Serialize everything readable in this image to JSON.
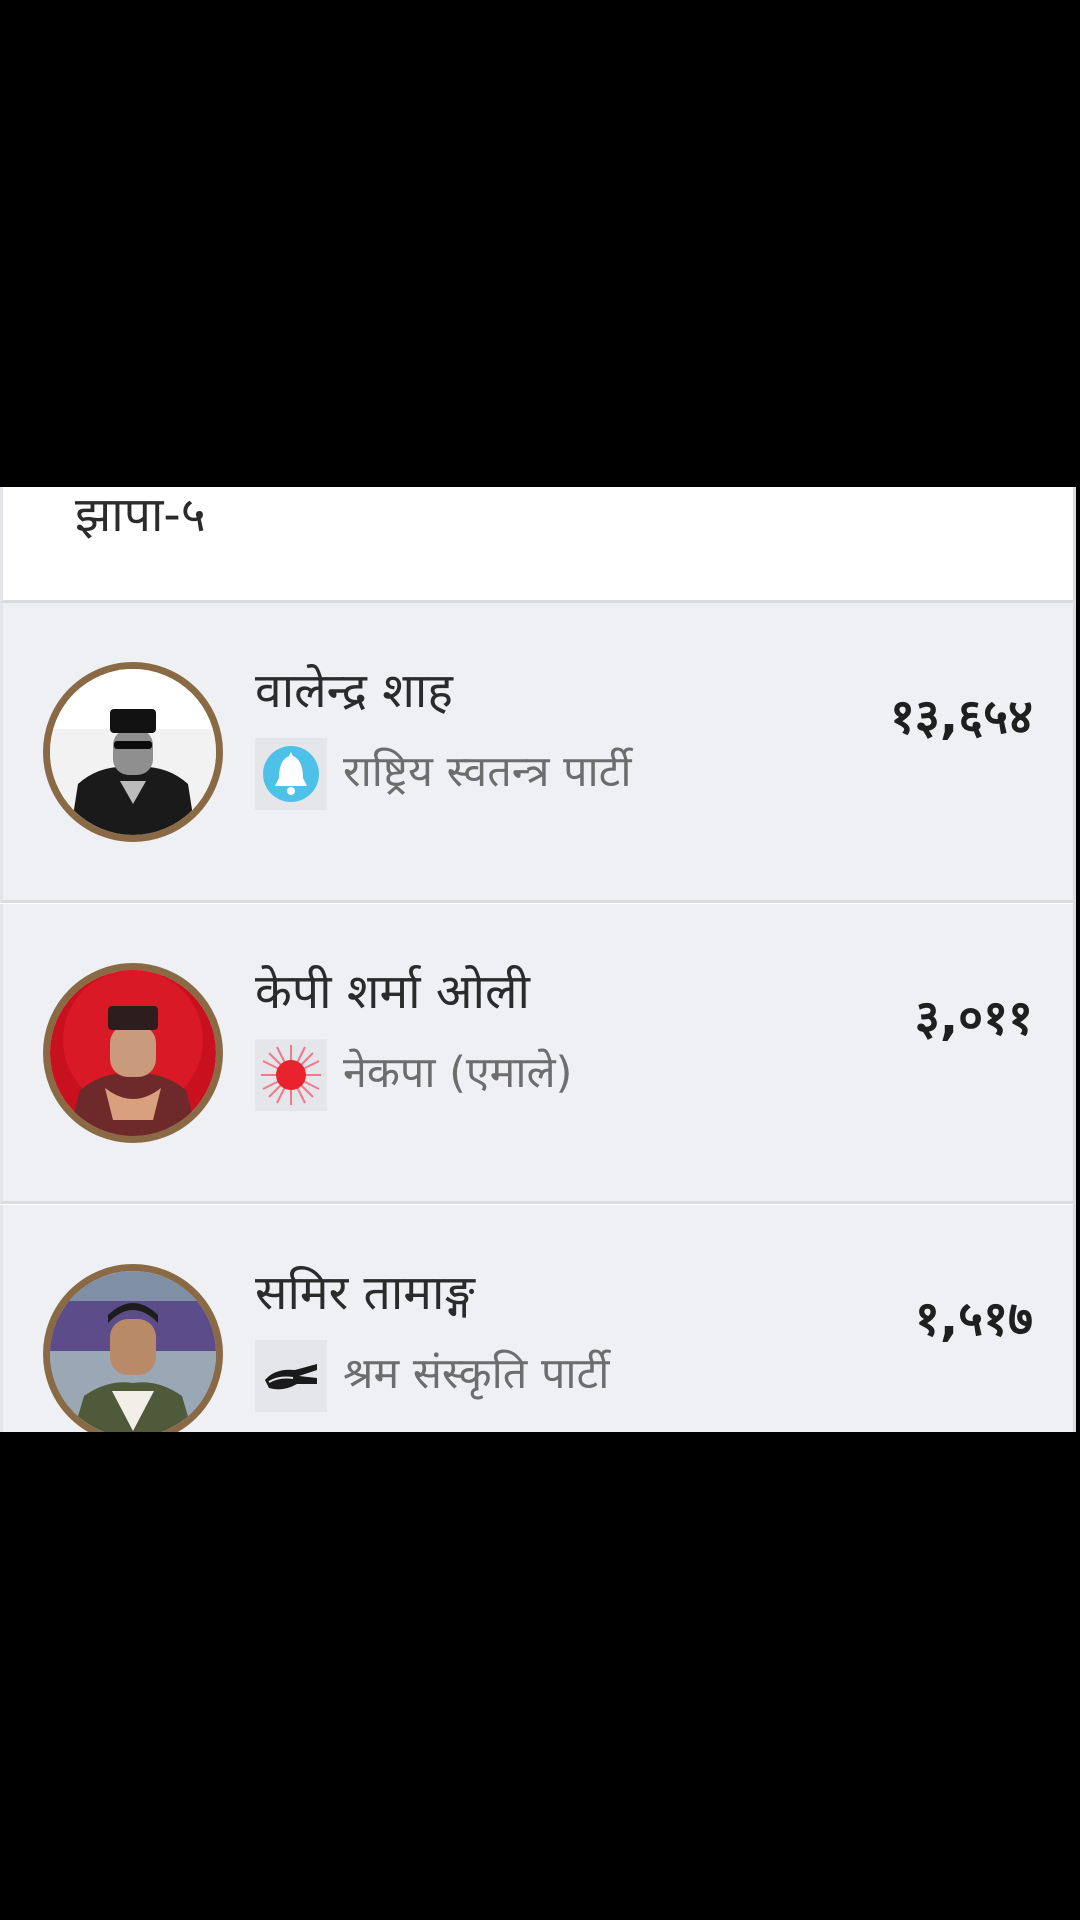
{
  "constituency": {
    "title": "झापा-५"
  },
  "candidates": [
    {
      "name": "वालेन्द्र शाह",
      "party": "राष्ट्रिय स्वतन्त्र पार्टी",
      "party_icon": "bell-icon",
      "votes": "१३,६५४"
    },
    {
      "name": "केपी शर्मा ओली",
      "party": "नेकपा (एमाले)",
      "party_icon": "sun-icon",
      "votes": "३,०११"
    },
    {
      "name": "समिर तामाङ्ग",
      "party": "श्रम संस्कृति पार्टी",
      "party_icon": "hands-icon",
      "votes": "१,५१७"
    }
  ],
  "colors": {
    "avatar_ring": "#8a6a45",
    "row_bg": "#eef0f4",
    "bell_party": "#4ec1e8",
    "sun_party": "#e8232e"
  }
}
